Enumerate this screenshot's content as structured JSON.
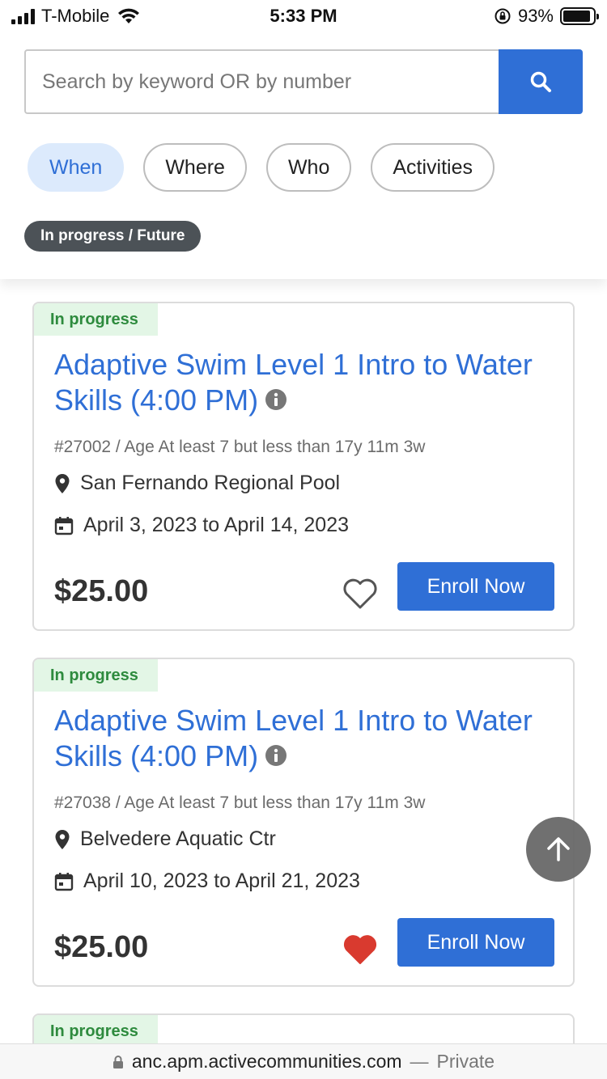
{
  "status_bar": {
    "carrier": "T-Mobile",
    "time": "5:33 PM",
    "battery": "93%",
    "battery_level": 0.93
  },
  "search": {
    "placeholder": "Search by keyword OR by number"
  },
  "filters": [
    {
      "label": "When",
      "active": true
    },
    {
      "label": "Where",
      "active": false
    },
    {
      "label": "Who",
      "active": false
    },
    {
      "label": "Activities",
      "active": false
    }
  ],
  "status_filter": "In progress / Future",
  "cards": [
    {
      "badge": "In progress",
      "title": "Adaptive Swim Level 1 Intro to Water Skills (4:00 PM)",
      "meta": "#27002 / Age At least 7 but less than 17y 11m 3w",
      "location": "San Fernando Regional Pool",
      "dates": "April 3, 2023 to April 14, 2023",
      "price": "$25.00",
      "favorited": false,
      "enroll_label": "Enroll Now"
    },
    {
      "badge": "In progress",
      "title": "Adaptive Swim Level 1 Intro to Water Skills (4:00 PM)",
      "meta": "#27038 / Age At least 7 but less than 17y 11m 3w",
      "location": "Belvedere Aquatic Ctr",
      "dates": "April 10, 2023 to April 21, 2023",
      "price": "$25.00",
      "favorited": true,
      "enroll_label": "Enroll Now"
    },
    {
      "badge": "In progress"
    }
  ],
  "colors": {
    "accent": "#2f6fd6",
    "badge_text": "#2e8b3e",
    "badge_bg": "#e3f6e6",
    "heart_active": "#d93a2f"
  },
  "url_bar": {
    "url": "anc.apm.activecommunities.com",
    "separator": "—",
    "mode": "Private"
  }
}
